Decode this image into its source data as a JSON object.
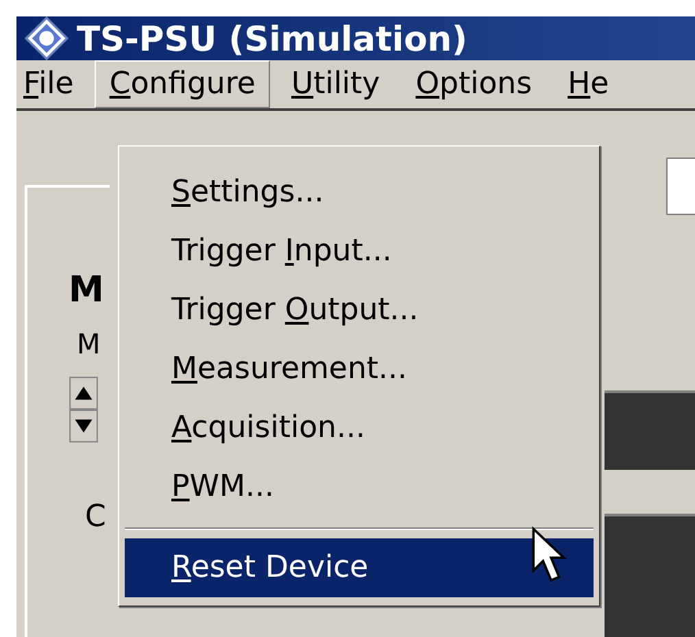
{
  "window": {
    "title": "TS-PSU (Simulation)"
  },
  "menu_bar": [
    {
      "access_key": "F",
      "text_after": "ile",
      "selected": false
    },
    {
      "access_key": "C",
      "text_after": "onfigure",
      "selected": true
    },
    {
      "access_key": "U",
      "text_after": "tility",
      "selected": false
    },
    {
      "access_key": "O",
      "text_after": "ptions",
      "selected": false
    },
    {
      "access_key": "H",
      "text_after": "e",
      "selected": false
    }
  ],
  "menu": [
    {
      "kind": "item",
      "access_key": "S",
      "text_after": "ettings...",
      "selected": false
    },
    {
      "kind": "item",
      "text_before": "Trigger ",
      "access_key": "I",
      "text_after": "nput...",
      "selected": false
    },
    {
      "kind": "item",
      "text_before": "Trigger ",
      "access_key": "O",
      "text_after": "utput...",
      "selected": false
    },
    {
      "kind": "item",
      "access_key": "M",
      "text_after": "easurement...",
      "selected": false
    },
    {
      "kind": "item",
      "access_key": "A",
      "text_after": "cquisition...",
      "selected": false
    },
    {
      "kind": "item",
      "access_key": "P",
      "text_after": "WM...",
      "selected": false
    },
    {
      "kind": "separator"
    },
    {
      "kind": "item",
      "access_key": "R",
      "text_after": "eset Device",
      "selected": true
    }
  ],
  "panel": {
    "heading": "M",
    "label_1": "M",
    "label_2": "C"
  }
}
